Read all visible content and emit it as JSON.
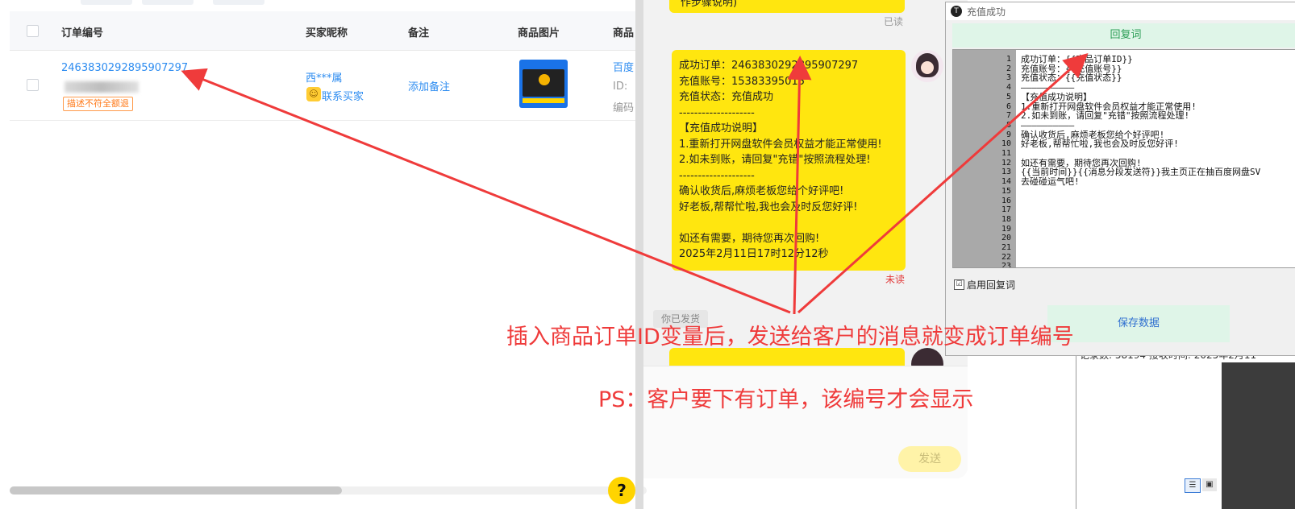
{
  "order_table": {
    "headers": {
      "order_no": "订单编号",
      "buyer": "买家昵称",
      "remark": "备注",
      "image": "商品图片",
      "product": "商品"
    },
    "row": {
      "order_no": "2463830292895907297",
      "refund_badge": "描述不符全额退",
      "buyer_name": "西***属",
      "contact_buyer": "联系买家",
      "add_remark": "添加备注",
      "product_title": "百度",
      "product_id_label": "ID:",
      "product_code_label": "编码"
    },
    "help_label": "?"
  },
  "chat": {
    "top_bubble_fragment": "作步骤说明)",
    "read_status": "已读",
    "message_lines": [
      "成功订单：2463830292895907297",
      "充值账号：15383395015",
      "充值状态：充值成功",
      "--------------------",
      "【充值成功说明】",
      "1.重新打开网盘软件会员权益才能正常使用!",
      "2.如未到账，请回复\"充错\"按照流程处理!",
      "--------------------",
      "确认收货后,麻烦老板您给个好评吧!",
      "好老板,帮帮忙啦,我也会及时反您好评!",
      "",
      "如还有需要，期待您再次回购!",
      "2025年2月11日17时12分12秒"
    ],
    "unread_status": "未读",
    "shipped_tag": "你已发货",
    "send_label": "发送"
  },
  "dialog": {
    "title": "充值成功",
    "reply_label": "回复词",
    "line_numbers": [
      "1",
      "2",
      "3",
      "4",
      "5",
      "6",
      "7",
      "8",
      "9",
      "10",
      "11",
      "12",
      "13",
      "14",
      "15",
      "16",
      "17",
      "18",
      "19",
      "20",
      "21",
      "22",
      "23"
    ],
    "code_lines": [
      "成功订单：{{商品订单ID}}",
      "充值账号：{{充值账号}}",
      "充值状态：{{充值状态}}",
      "——————————",
      "【充值成功说明】",
      "1.重新打开网盘软件会员权益才能正常使用!",
      "2.如未到账，请回复\"充错\"按照流程处理!",
      "——————————",
      "确认收货后,麻烦老板您给个好评吧!",
      "好老板,帮帮忙啦,我也会及时反您好评!",
      "",
      "如还有需要，期待您再次回购!",
      "{{当前时间}}{{消息分段发送符}}我主页正在抽百度网盘SV",
      "去碰碰运气吧!"
    ],
    "enable_reply_label": "启用回复词",
    "enable_reply_checked": "☑",
    "save_label": "保存数据"
  },
  "background_window": {
    "info": "记录数: 58194    接收时间: 2025年2月11"
  },
  "annotations": {
    "main_note": "插入商品订单ID变量后，发送给客户的消息就变成订单编号",
    "ps_note": "PS：客户要下有订单，该编号才会显示"
  },
  "colors": {
    "accent_yellow": "#ffe60f",
    "link_blue": "#2d8cf0",
    "annotation_red": "#ef3b3b",
    "dialog_green": "#dff5e8"
  }
}
